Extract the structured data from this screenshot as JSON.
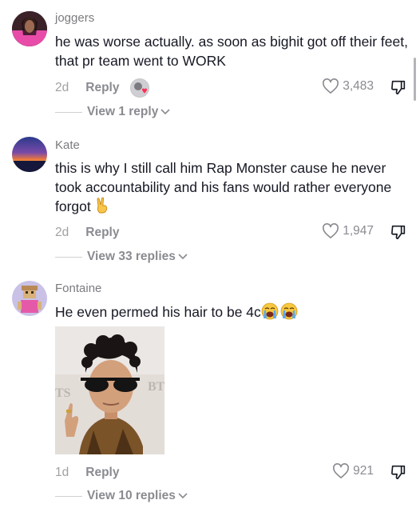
{
  "comments": [
    {
      "username": "joggers",
      "text": "he was worse actually. as soon as bighit got off their feet, that pr team went to WORK",
      "time": "2d",
      "reply_label": "Reply",
      "likes": "3,483",
      "view_replies": "View 1 reply"
    },
    {
      "username": "Kate",
      "text": "this is why I still call him Rap Monster cause he never took accountability and his fans would rather everyone forgot",
      "emoji": "victory-hand",
      "time": "2d",
      "reply_label": "Reply",
      "likes": "1,947",
      "view_replies": "View 33 replies"
    },
    {
      "username": "Fontaine",
      "text": "He even permed his hair to be 4c",
      "emoji": "loudly-crying-face x2",
      "image_text": {
        "left": "TS",
        "right": "BT"
      },
      "time": "1d",
      "reply_label": "Reply",
      "likes": "921",
      "view_replies": "View 10 replies"
    }
  ],
  "colors": {
    "text": "#161823",
    "muted": "#8a8b91",
    "heart_badge": "#fe2c55"
  }
}
